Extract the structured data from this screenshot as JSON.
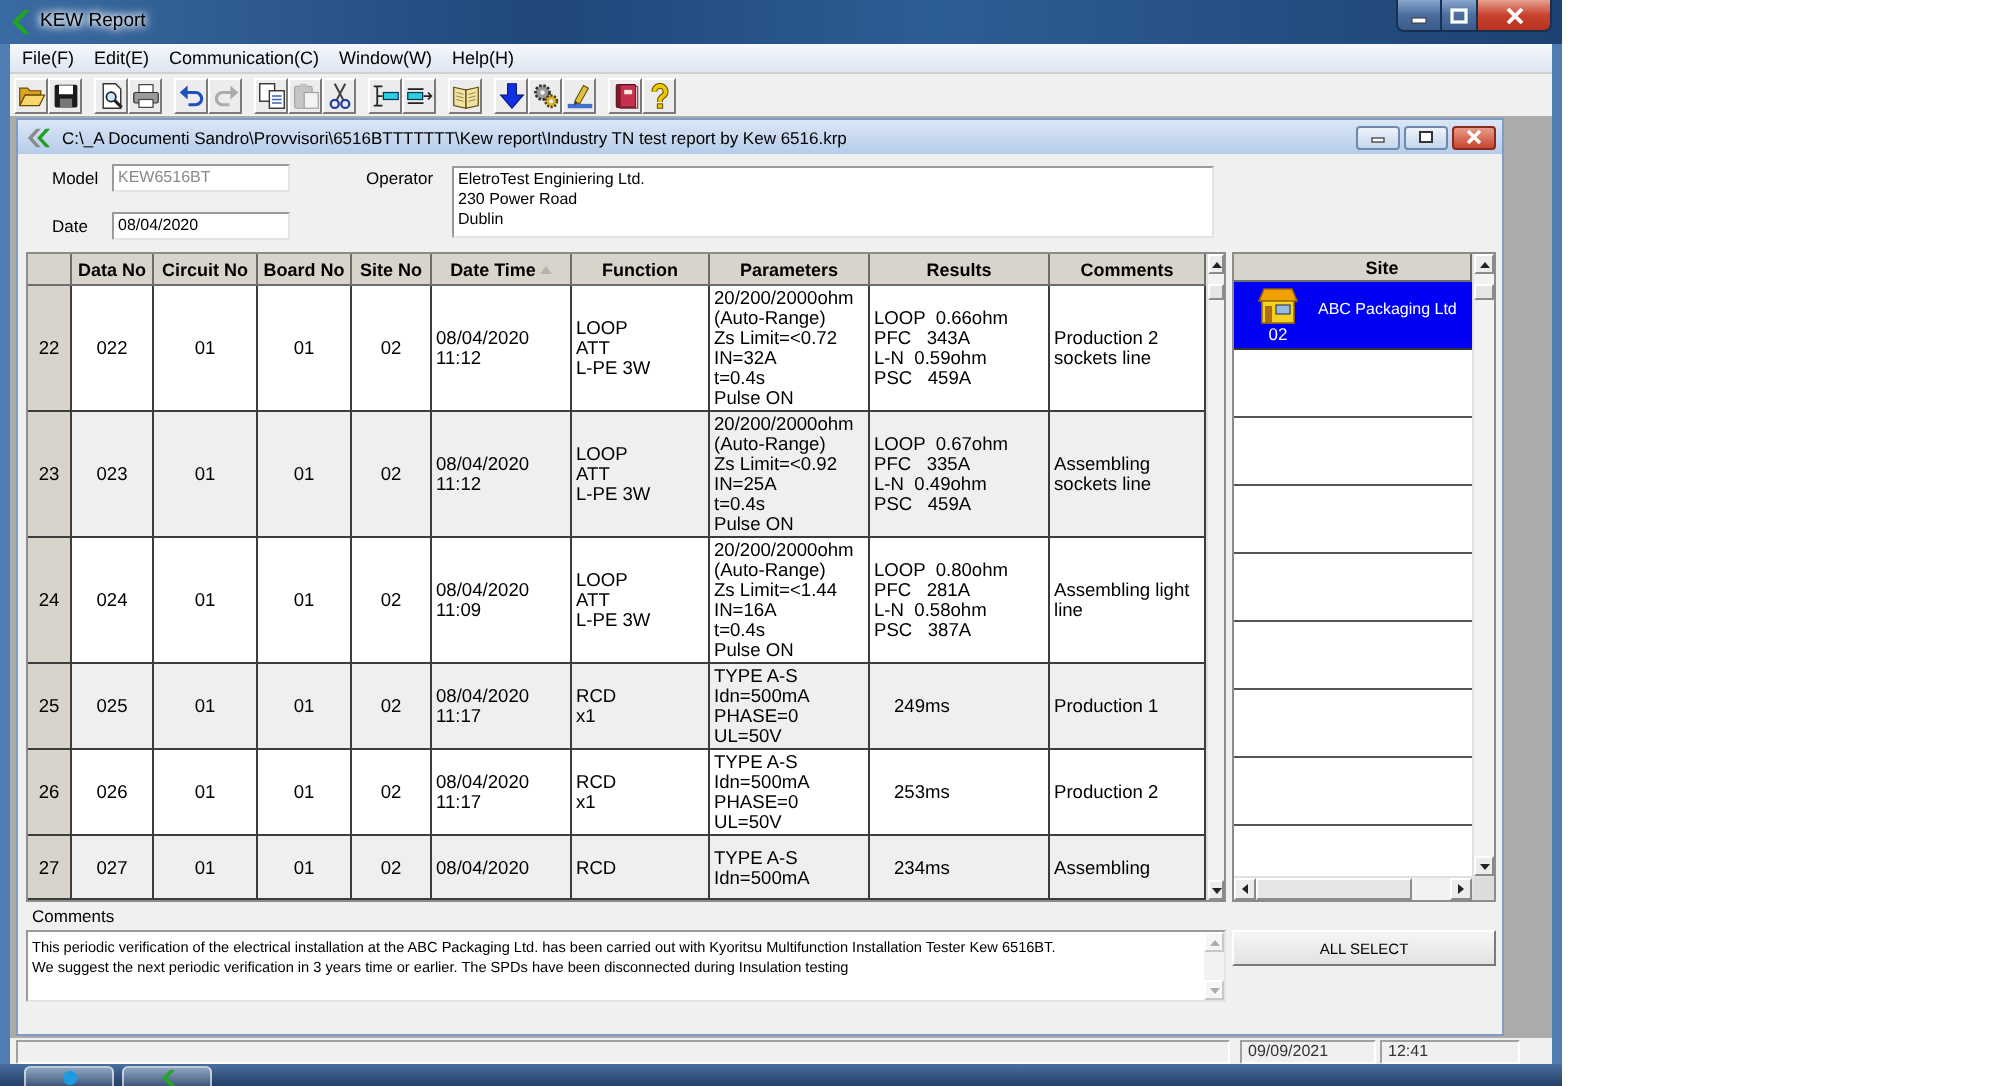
{
  "window": {
    "title": "KEW Report"
  },
  "menu": [
    {
      "label": "File(F)"
    },
    {
      "label": "Edit(E)"
    },
    {
      "label": "Communication(C)"
    },
    {
      "label": "Window(W)"
    },
    {
      "label": "Help(H)"
    }
  ],
  "toolbar": {
    "groups": [
      {
        "buttons": [
          {
            "kind": "open",
            "disabled": false
          },
          {
            "kind": "save",
            "disabled": false
          }
        ]
      },
      {
        "buttons": [
          {
            "kind": "preview",
            "disabled": false
          },
          {
            "kind": "print",
            "disabled": false
          }
        ]
      },
      {
        "buttons": [
          {
            "kind": "undo",
            "disabled": false
          },
          {
            "kind": "redo",
            "disabled": true
          }
        ]
      },
      {
        "buttons": [
          {
            "kind": "copy",
            "disabled": false
          },
          {
            "kind": "paste",
            "disabled": true
          },
          {
            "kind": "cut",
            "disabled": false
          }
        ]
      },
      {
        "buttons": [
          {
            "kind": "indent_in",
            "disabled": false
          },
          {
            "kind": "indent_out",
            "disabled": false
          }
        ]
      },
      {
        "buttons": [
          {
            "kind": "book",
            "disabled": false
          }
        ]
      },
      {
        "buttons": [
          {
            "kind": "download",
            "disabled": false
          },
          {
            "kind": "gears",
            "disabled": false
          },
          {
            "kind": "tool",
            "disabled": false
          }
        ]
      },
      {
        "buttons": [
          {
            "kind": "manual",
            "disabled": false
          },
          {
            "kind": "help",
            "disabled": false
          }
        ]
      }
    ]
  },
  "document": {
    "path": "C:\\_A Documenti Sandro\\Provvisori\\6516BTTTTTTT\\Kew report\\Industry TN test report by Kew 6516.krp",
    "model": {
      "label": "Model",
      "value": "KEW6516BT",
      "disabled": true
    },
    "date": {
      "label": "Date",
      "value": "08/04/2020",
      "disabled": false
    },
    "operator": {
      "label": "Operator",
      "value": "EletroTest Enginiering Ltd.\n230 Power Road\nDublin"
    },
    "table": {
      "columns": [
        {
          "label": "Data No",
          "sorted": false
        },
        {
          "label": "Circuit No",
          "sorted": false
        },
        {
          "label": "Board No",
          "sorted": false
        },
        {
          "label": "Site No",
          "sorted": false
        },
        {
          "label": "Date Time",
          "sorted": true
        },
        {
          "label": "Function",
          "sorted": false
        },
        {
          "label": "Parameters",
          "sorted": false
        },
        {
          "label": "Results",
          "sorted": false
        },
        {
          "label": "Comments",
          "sorted": false
        }
      ],
      "rows": [
        {
          "number": "22",
          "kind": "loop",
          "cells": [
            "022",
            "01",
            "01",
            "02",
            "08/04/2020\n11:12",
            "LOOP\nATT\nL-PE 3W",
            "20/200/2000ohm\n(Auto-Range)\nZs Limit=<0.72\nIN=32A\nt=0.4s\nPulse ON",
            "LOOP  0.66ohm\nPFC   343A\nL-N  0.59ohm\nPSC   459A",
            "Production 2 sockets line"
          ]
        },
        {
          "number": "23",
          "kind": "loop",
          "cells": [
            "023",
            "01",
            "01",
            "02",
            "08/04/2020\n11:12",
            "LOOP\nATT\nL-PE 3W",
            "20/200/2000ohm\n(Auto-Range)\nZs Limit=<0.92\nIN=25A\nt=0.4s\nPulse ON",
            "LOOP  0.67ohm\nPFC   335A\nL-N  0.49ohm\nPSC   459A",
            "Assembling sockets line"
          ]
        },
        {
          "number": "24",
          "kind": "loop",
          "cells": [
            "024",
            "01",
            "01",
            "02",
            "08/04/2020\n11:09",
            "LOOP\nATT\nL-PE 3W",
            "20/200/2000ohm\n(Auto-Range)\nZs Limit=<1.44\nIN=16A\nt=0.4s\nPulse ON",
            "LOOP  0.80ohm\nPFC   281A\nL-N  0.58ohm\nPSC   387A",
            "Assembling light line"
          ]
        },
        {
          "number": "25",
          "kind": "rcd",
          "cells": [
            "025",
            "01",
            "01",
            "02",
            "08/04/2020\n11:17",
            "RCD\nx1",
            "TYPE A-S\nIdn=500mA\nPHASE=0\nUL=50V",
            "249ms",
            "Production 1"
          ]
        },
        {
          "number": "26",
          "kind": "rcd",
          "cells": [
            "026",
            "01",
            "01",
            "02",
            "08/04/2020\n11:17",
            "RCD\nx1",
            "TYPE A-S\nIdn=500mA\nPHASE=0\nUL=50V",
            "253ms",
            "Production 2"
          ]
        },
        {
          "number": "27",
          "kind": "rcd",
          "cells": [
            "027",
            "01",
            "01",
            "02",
            "08/04/2020",
            "RCD",
            "TYPE A-S\nIdn=500mA",
            "234ms",
            "Assembling"
          ]
        }
      ]
    },
    "sites": {
      "column": "Site",
      "items": [
        {
          "number": "02",
          "name": "ABC Packaging Ltd",
          "selected": true
        }
      ]
    },
    "comments": {
      "label": "Comments",
      "value": "This periodic verification of the electrical installation at the ABC Packaging Ltd. has been carried out with Kyoritsu Multifunction Installation Tester Kew 6516BT.\nWe suggest the next periodic verification in 3 years time or earlier. The SPDs have been disconnected during Insulation testing"
    },
    "all_select_button": "ALL SELECT"
  },
  "status_bar": {
    "date": "09/09/2021",
    "time": "12:41"
  }
}
